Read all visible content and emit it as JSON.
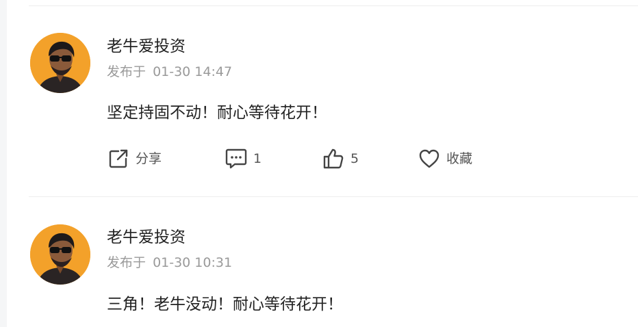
{
  "posts": [
    {
      "username": "老牛爱投资",
      "published_prefix": "发布于",
      "published_time": "01-30 14:47",
      "content": "坚定持固不动！耐心等待花开！",
      "actions": {
        "share_label": "分享",
        "comment_count": "1",
        "like_count": "5",
        "favorite_label": "收藏"
      }
    },
    {
      "username": "老牛爱投资",
      "published_prefix": "发布于",
      "published_time": "01-30 10:31",
      "content": "三角！老牛没动！耐心等待花开！"
    }
  ],
  "icons": {
    "share": "share-icon",
    "comment": "comment-icon",
    "like": "thumbs-up-icon",
    "favorite": "heart-icon"
  },
  "colors": {
    "avatar_background": "#f3a12a",
    "text_primary": "#222222",
    "text_secondary": "#999999",
    "icon_color": "#444444",
    "divider": "#ededed"
  }
}
